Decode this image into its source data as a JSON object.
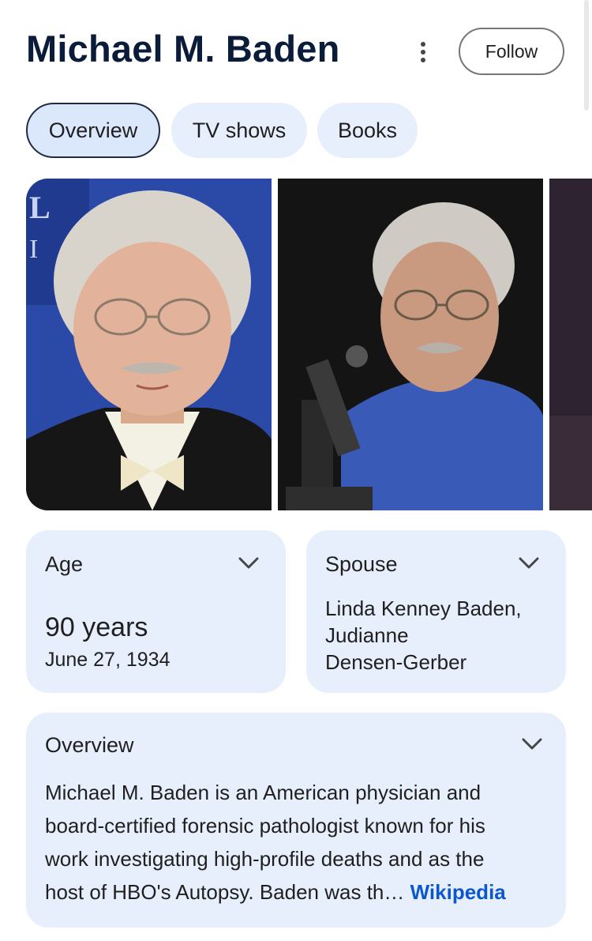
{
  "header": {
    "title": "Michael M. Baden",
    "follow_label": "Follow"
  },
  "chips": [
    {
      "label": "Overview",
      "active": true
    },
    {
      "label": "TV shows",
      "active": false
    },
    {
      "label": "Books",
      "active": false
    }
  ],
  "images": [
    {
      "description": "photo-1"
    },
    {
      "description": "photo-2"
    },
    {
      "description": "photo-3"
    }
  ],
  "age_card": {
    "label": "Age",
    "value": "90 years",
    "date": "June 27, 1934"
  },
  "spouse_card": {
    "label": "Spouse",
    "line1": "Linda Kenney Baden,",
    "line2": "Judianne",
    "line3": "Densen-Gerber"
  },
  "overview_card": {
    "label": "Overview",
    "line1": "Michael M. Baden is an American physician and",
    "line2": "board-certified forensic pathologist known for his",
    "line3": "work investigating high-profile deaths and as the",
    "line4": "host of HBO's Autopsy. Baden was th…",
    "link": "Wikipedia"
  },
  "colors": {
    "card_bg": "#e8effc",
    "chip_bg": "#e8effc",
    "link": "#0b57d0",
    "title": "#0b1b3a"
  }
}
